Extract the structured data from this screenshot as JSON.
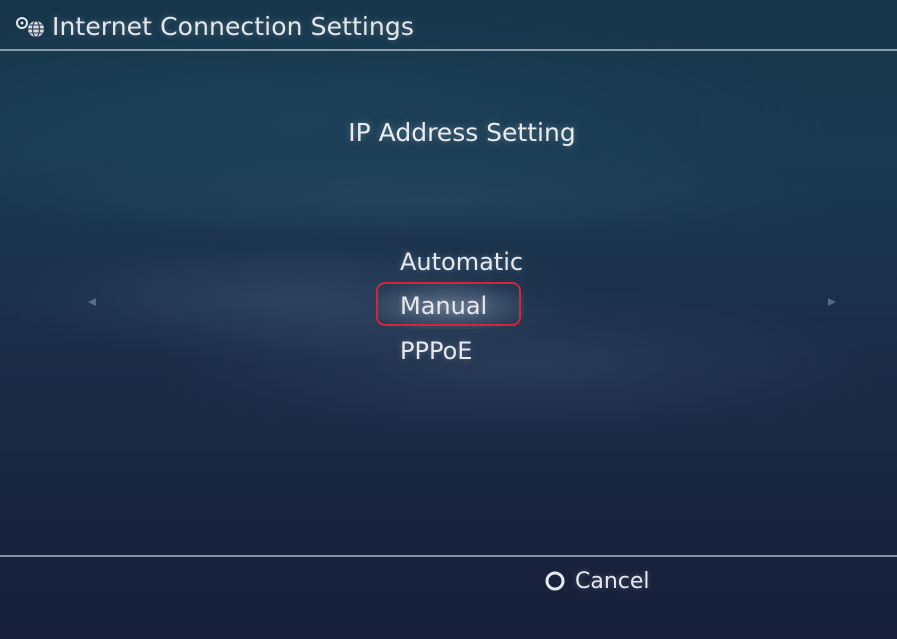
{
  "header": {
    "title": "Internet Connection Settings",
    "icon": "network-globe-icon"
  },
  "main": {
    "heading": "IP Address Setting",
    "options": [
      {
        "label": "Automatic",
        "selected": false
      },
      {
        "label": "Manual",
        "selected": true
      },
      {
        "label": "PPPoE",
        "selected": false
      }
    ],
    "scroll_left_icon": "left-arrow-icon",
    "scroll_right_icon": "right-arrow-icon",
    "highlight_color": "#d4253b"
  },
  "footer": {
    "cancel_icon": "circle-button-icon",
    "cancel_label": "Cancel"
  }
}
